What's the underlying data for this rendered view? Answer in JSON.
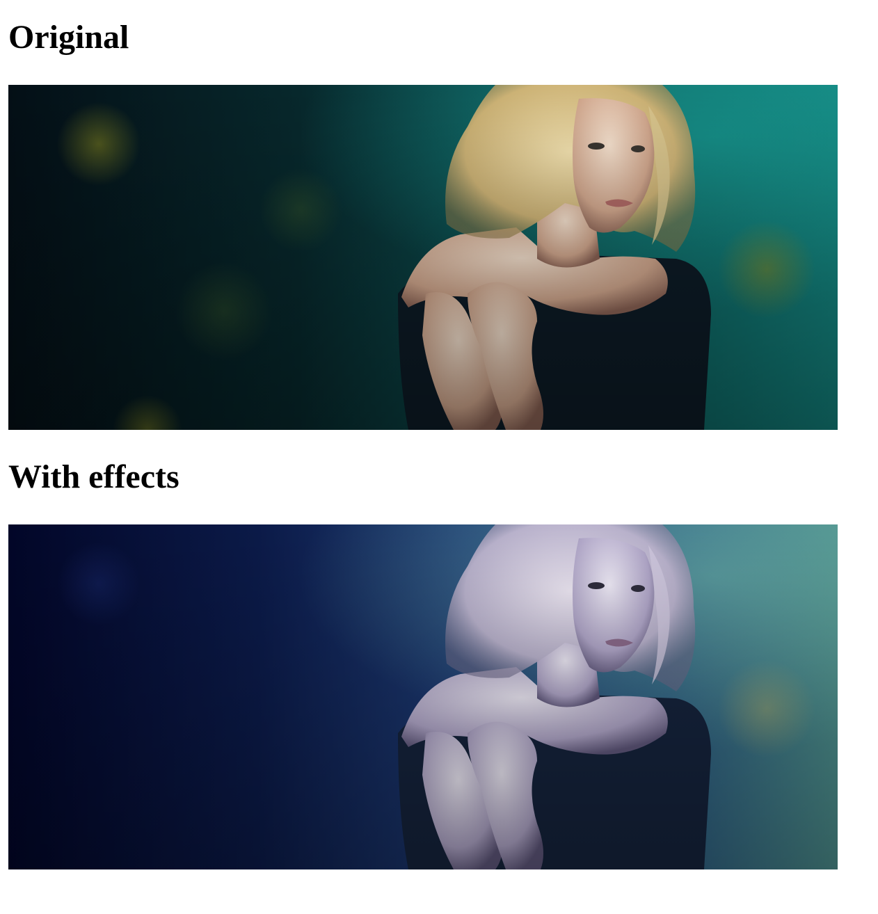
{
  "sections": {
    "original": {
      "heading": "Original",
      "image_alt": "Portrait of a blonde woman against a dark teal bokeh background"
    },
    "effects": {
      "heading": "With effects",
      "image_alt": "Same portrait with a cool blue color-grading effect applied"
    }
  },
  "colors": {
    "original_bg_dark": "#04151c",
    "original_bg_teal": "#127a76",
    "original_hair": "#d8c48a",
    "original_skin": "#e8c8b0",
    "effects_bg_dark": "#040a2e",
    "effects_bg_blue": "#2b4d85",
    "effects_hair": "#c8c2d8",
    "effects_skin": "#c4bcd6"
  }
}
